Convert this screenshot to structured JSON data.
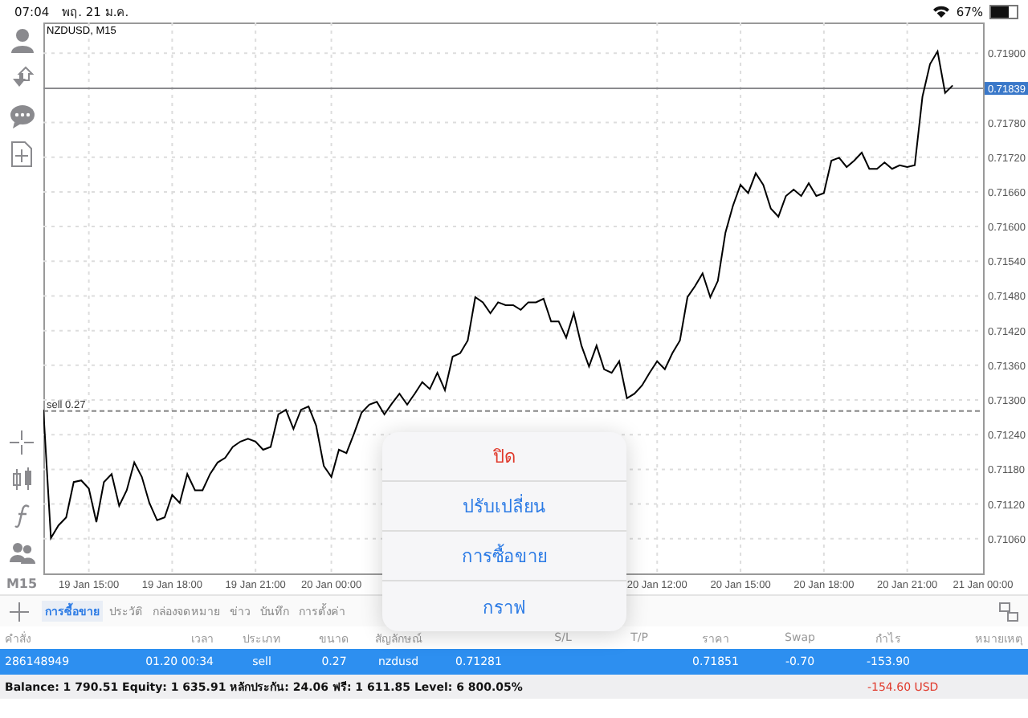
{
  "status_bar": {
    "time": "07:04",
    "date": "พฤ. 21 ม.ค.",
    "battery_text": "67%",
    "battery": {
      "level": 0.67
    }
  },
  "chart": {
    "timeframe_label": "M15",
    "chart_data": {
      "type": "line",
      "grid": true,
      "categories": [
        null,
        null,
        null,
        null,
        null,
        null,
        "19 Jan 15:00",
        null,
        null,
        null,
        null,
        null,
        null,
        null,
        null,
        null,
        null,
        "19 Jan 18:00",
        null,
        null,
        null,
        null,
        null,
        null,
        null,
        null,
        null,
        null,
        "19 Jan 21:00",
        null,
        null,
        null,
        null,
        null,
        null,
        null,
        null,
        null,
        "20 Jan 00:00",
        null,
        null,
        null,
        null,
        null,
        null,
        null,
        null,
        null,
        null,
        null,
        null,
        null,
        null,
        null,
        null,
        null,
        null,
        null,
        null,
        null,
        null,
        null,
        null,
        null,
        null,
        null,
        null,
        null,
        null,
        null,
        null,
        null,
        null,
        null,
        null,
        null,
        null,
        null,
        null,
        null,
        null,
        "20 Jan 12:00",
        null,
        null,
        null,
        null,
        null,
        null,
        null,
        null,
        null,
        null,
        "20 Jan 15:00",
        null,
        null,
        null,
        null,
        null,
        null,
        null,
        null,
        null,
        null,
        "20 Jan 18:00",
        null,
        null,
        null,
        null,
        null,
        null,
        null,
        null,
        null,
        null,
        "20 Jan 21:00",
        null,
        null,
        null,
        null,
        null,
        null,
        null,
        null,
        null,
        "21 Jan 00:00"
      ],
      "series": [
        {
          "name": "NZDUSD, M15",
          "color": "#000000",
          "values": [
            0.71283,
            0.71061,
            0.71083,
            0.71097,
            0.71158,
            0.71161,
            0.71147,
            0.71089,
            0.71158,
            0.71172,
            0.71117,
            0.71144,
            0.71192,
            0.71167,
            0.71122,
            0.71092,
            0.71097,
            0.71136,
            0.71122,
            0.71172,
            0.71144,
            0.71144,
            0.71172,
            0.71192,
            0.712,
            0.71219,
            0.71228,
            0.71233,
            0.71228,
            0.71214,
            0.71219,
            0.71275,
            0.71283,
            0.7125,
            0.71283,
            0.71289,
            0.71256,
            0.71186,
            0.71167,
            0.71214,
            0.71208,
            0.71242,
            0.71278,
            0.71292,
            0.71297,
            0.71275,
            0.71294,
            0.71311,
            0.71292,
            0.71311,
            0.71331,
            0.71319,
            0.71347,
            0.71317,
            0.71375,
            0.71381,
            0.71403,
            0.71478,
            0.71469,
            0.7145,
            0.71469,
            0.71464,
            0.71464,
            0.71456,
            0.71469,
            0.71469,
            0.71475,
            0.71436,
            0.71436,
            0.71408,
            0.7145,
            0.71394,
            0.71358,
            0.71394,
            0.71353,
            0.71347,
            0.71367,
            0.71303,
            0.71311,
            0.71325,
            0.71347,
            0.71367,
            0.71353,
            0.71381,
            0.71403,
            0.71478,
            0.71497,
            0.71519,
            0.71478,
            0.71506,
            0.71589,
            0.71636,
            0.71672,
            0.71658,
            0.71692,
            0.71672,
            0.71631,
            0.71617,
            0.71653,
            0.71664,
            0.71653,
            0.71675,
            0.71653,
            0.71658,
            0.71714,
            0.71719,
            0.71703,
            0.71714,
            0.71728,
            0.717,
            0.717,
            0.71711,
            0.717,
            0.71706,
            0.71703,
            0.71706,
            0.71825,
            0.71881,
            0.71903,
            0.71831,
            0.71844,
            null,
            null,
            null,
            null
          ]
        }
      ],
      "ylim": [
        0.71,
        0.71953
      ],
      "yticks": [
        {
          "value": 0.719,
          "label": "0.71900"
        },
        {
          "value": 0.7178,
          "label": "0.71780"
        },
        {
          "value": 0.7172,
          "label": "0.71720"
        },
        {
          "value": 0.7166,
          "label": "0.71660"
        },
        {
          "value": 0.716,
          "label": "0.71600"
        },
        {
          "value": 0.7154,
          "label": "0.71540"
        },
        {
          "value": 0.7148,
          "label": "0.71480"
        },
        {
          "value": 0.7142,
          "label": "0.71420"
        },
        {
          "value": 0.7136,
          "label": "0.71360"
        },
        {
          "value": 0.713,
          "label": "0.71300"
        },
        {
          "value": 0.7124,
          "label": "0.71240"
        },
        {
          "value": 0.7118,
          "label": "0.71180"
        },
        {
          "value": 0.7112,
          "label": "0.71120"
        },
        {
          "value": 0.7106,
          "label": "0.71060"
        }
      ],
      "ref_lines": [
        {
          "axis": "y",
          "value": 0.71839,
          "label": "0.71839"
        },
        {
          "axis": "y",
          "value": 0.71281,
          "label": "sell 0.27"
        }
      ]
    }
  },
  "tabs": [
    {
      "label": "การซื้อขาย",
      "selected": true
    },
    {
      "label": "ประวัติ",
      "selected": false
    },
    {
      "label": "กล่องจดหมาย",
      "selected": false
    },
    {
      "label": "ข่าว",
      "selected": false
    },
    {
      "label": "บันทึก",
      "selected": false
    },
    {
      "label": "การตั้งค่า",
      "selected": false
    }
  ],
  "table": {
    "columns": [
      "คำสั่ง",
      "เวลา",
      "ประเภท",
      "ขนาด",
      "สัญลักษณ์",
      "",
      "S/L",
      "T/P",
      "ราคา",
      "Swap",
      "กำไร",
      "หมายเหตุ"
    ],
    "rows": [
      {
        "selected": true,
        "cells": [
          "286148949",
          "01.20 00:34",
          "sell",
          "0.27",
          "nzdusd",
          "0.71281",
          "",
          "",
          "0.71851",
          "-0.70",
          "-153.90"
        ]
      }
    ]
  },
  "account": {
    "summary": "Balance: 1 790.51 Equity: 1 635.91 หลักประกัน: 24.06 ฟรี: 1 611.85 Level: 6 800.05%",
    "profit": "-154.60 USD"
  },
  "context_menu": {
    "items": [
      {
        "label": "ปิด",
        "kind": "destructive"
      },
      {
        "label": "ปรับเปลี่ยน",
        "kind": "default"
      },
      {
        "label": "การซื้อขาย",
        "kind": "default"
      },
      {
        "label": "กราฟ",
        "kind": "default"
      }
    ]
  }
}
